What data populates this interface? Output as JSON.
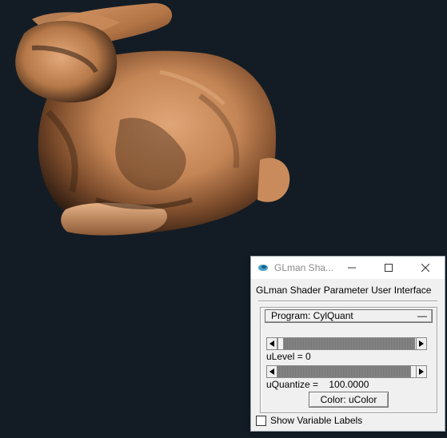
{
  "window": {
    "title": "GLman Sha...",
    "minimize_icon": "minimize-icon",
    "maximize_icon": "maximize-icon",
    "close_icon": "close-icon"
  },
  "panel": {
    "heading": "GLman Shader Parameter User Interface",
    "program_label": "Program: CylQuant",
    "program_collapse_glyph": "—",
    "uLevel": {
      "label": "uLevel = 0",
      "value": 0
    },
    "uQuantize": {
      "label": "uQuantize =    100.0000",
      "value": 100.0
    },
    "color_button": "Color: uColor",
    "show_labels": {
      "label": "Show Variable Labels",
      "checked": false
    }
  },
  "colors": {
    "background": "#131c25",
    "bunny": "#d9996a",
    "dialog": "#f0f0f0"
  }
}
